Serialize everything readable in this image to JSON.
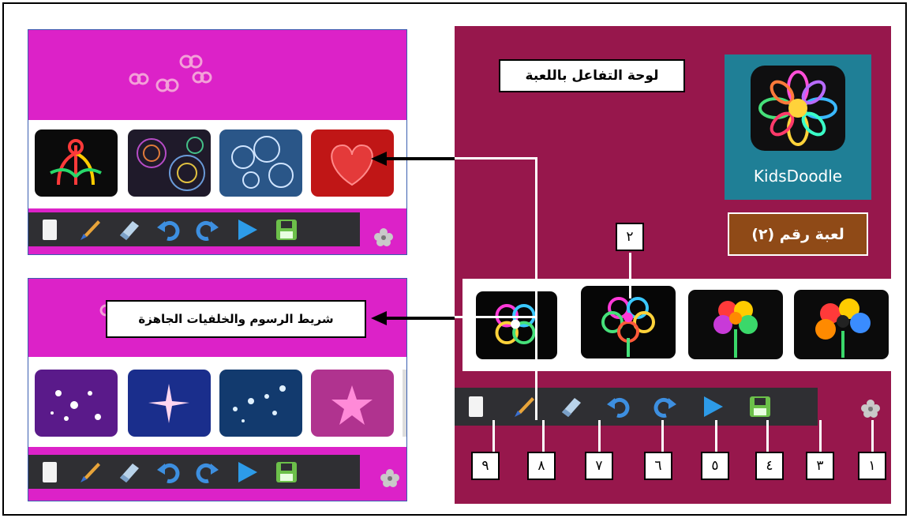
{
  "game_panel": {
    "title": "لوحة التفاعل باللعبة",
    "app_name": "KidsDoodle",
    "game_number": "لعبة رقم (٢)"
  },
  "callouts": {
    "drawings_bar": "شريط الرسوم والخلفيات الجاهزة"
  },
  "markers": {
    "m1": "١",
    "m2": "٢",
    "m3": "٣",
    "m4": "٤",
    "m5": "٥",
    "m6": "٦",
    "m7": "٧",
    "m8": "٨",
    "m9": "٩"
  },
  "toolbar_tools": [
    "new-page",
    "brush",
    "eraser",
    "undo",
    "redo",
    "play",
    "save",
    "settings"
  ],
  "colors": {
    "game_background": "#97174c",
    "pink_band": "#dc22c8",
    "toolbar": "#2f2f33",
    "app_icon_bg": "#1f7f96",
    "game_number_bg": "#8f4a17"
  }
}
